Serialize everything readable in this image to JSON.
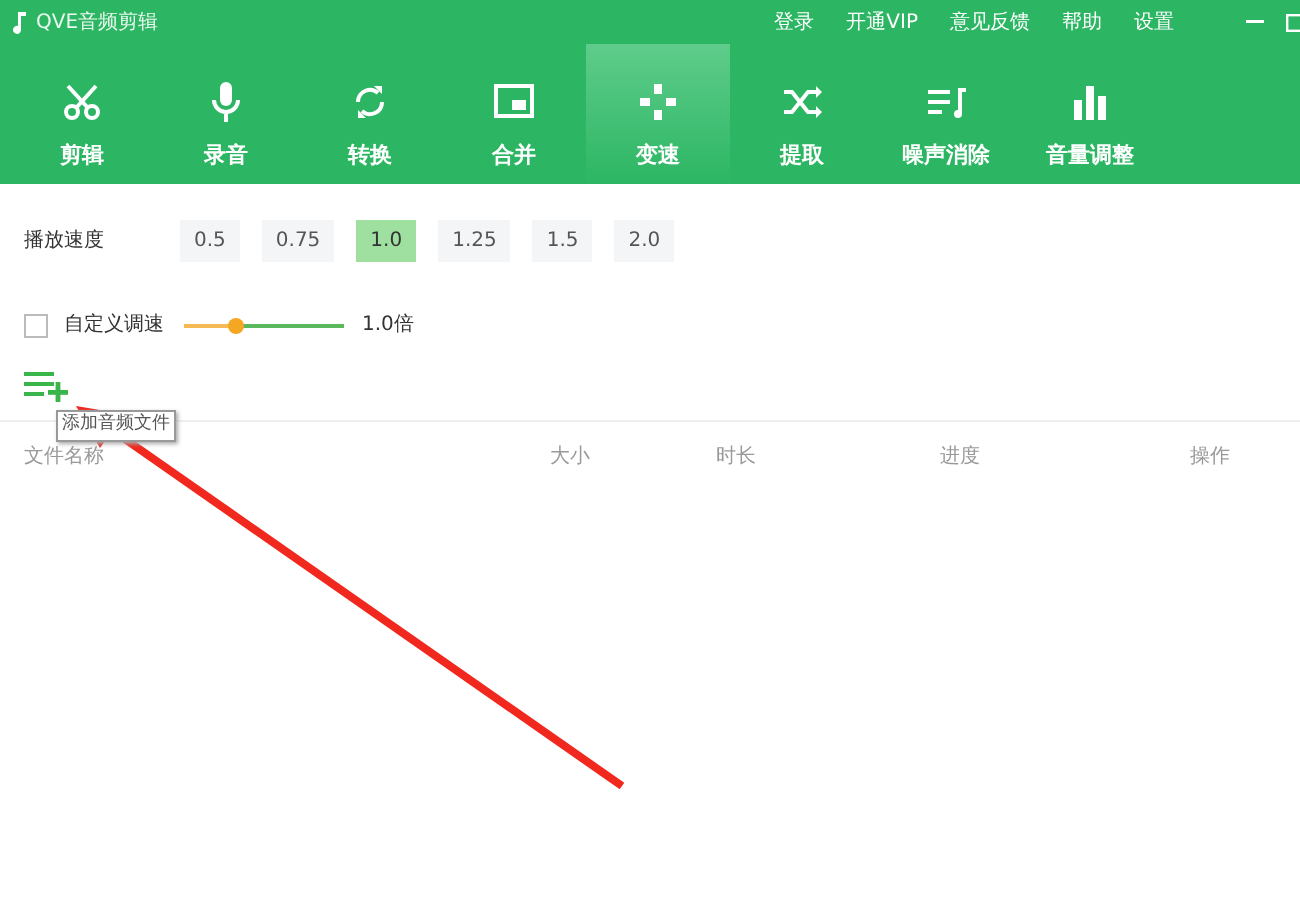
{
  "window": {
    "title": "QVE音频剪辑",
    "menu": [
      "登录",
      "开通VIP",
      "意见反馈",
      "帮助",
      "设置"
    ]
  },
  "tabs": [
    {
      "label": "剪辑",
      "selected": false
    },
    {
      "label": "录音",
      "selected": false
    },
    {
      "label": "转换",
      "selected": false
    },
    {
      "label": "合并",
      "selected": false
    },
    {
      "label": "变速",
      "selected": true
    },
    {
      "label": "提取",
      "selected": false
    },
    {
      "label": "噪声消除",
      "selected": false
    },
    {
      "label": "音量调整",
      "selected": false
    }
  ],
  "speed": {
    "label": "播放速度",
    "options": [
      {
        "label": "0.5",
        "selected": false
      },
      {
        "label": "0.75",
        "selected": false
      },
      {
        "label": "1.0",
        "selected": true
      },
      {
        "label": "1.25",
        "selected": false
      },
      {
        "label": "1.5",
        "selected": false
      },
      {
        "label": "2.0",
        "selected": false
      }
    ]
  },
  "custom": {
    "label": "自定义调速",
    "checked": false,
    "level": 0.33,
    "reading": "1.0倍"
  },
  "add_tooltip": "添加音频文件",
  "table": {
    "columns": [
      "文件名称",
      "大小",
      "时长",
      "进度",
      "操作"
    ]
  }
}
